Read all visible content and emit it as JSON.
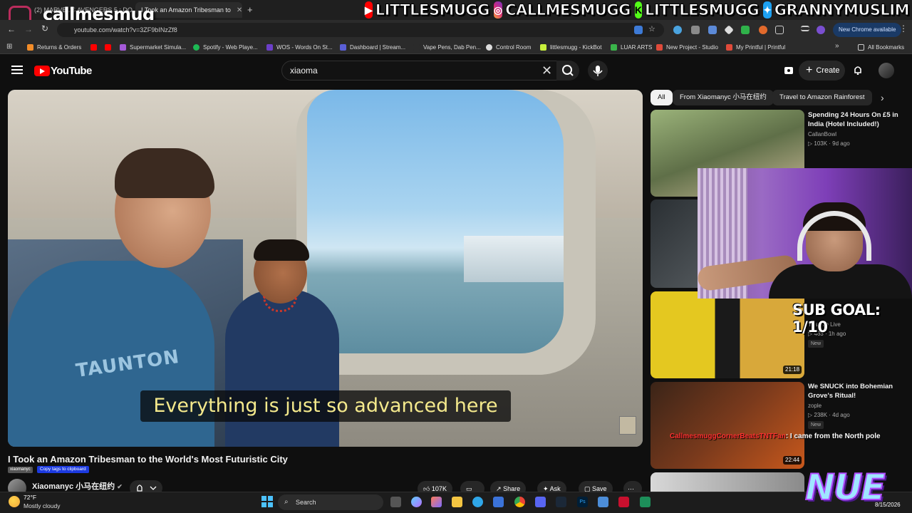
{
  "browser": {
    "tabs": [
      {
        "title": "(2) MARVEL'S AVENGERS 5 : DO",
        "active": false
      },
      {
        "title": "I Took an Amazon Tribesman to",
        "active": true
      }
    ],
    "url": "youtube.com/watch?v=3ZF9bINzZf8",
    "new_chrome_label": "New Chrome available",
    "bookmarks": [
      "Returns & Orders",
      "Supermarket Simula...",
      "Spotify - Web Playe...",
      "WOS - Words On St...",
      "Dashboard | Stream...",
      "Vape Pens, Dab Pen...",
      "Control Room",
      "littlesmugg - KickBot",
      "LUAR ARTS",
      "New Project - Studio",
      "My Printful | Printful"
    ],
    "all_bookmarks": "All Bookmarks"
  },
  "overlay": {
    "watermark": "callmesmug",
    "socials": [
      {
        "icon": "youtube-icon",
        "handle": "LITTLESMUGG",
        "color": "#ff0000"
      },
      {
        "icon": "instagram-icon",
        "handle": "CALLMESMUGG",
        "color": "#d6297a"
      },
      {
        "icon": "kick-icon",
        "handle": "LITTLESMUGG",
        "color": "#53fc18"
      },
      {
        "icon": "twitter-icon",
        "handle": "GRANNYMUSLIM",
        "color": "#1da1f2"
      }
    ],
    "sub_goal": "SUB GOAL: 1/10",
    "chat_name": "CallmesmuggCornerBeatsTNTFan",
    "chat_msg": ": I came from the North pole",
    "logo": "NUE",
    "date": "8/15/2026"
  },
  "youtube": {
    "logo": "YouTube",
    "search_query": "xiaoma",
    "create_label": "Create",
    "caption": "Everything is just so advanced here",
    "shirt_text": "TAUNTON",
    "video": {
      "title": "I Took an Amazon Tribesman to the World's Most Futuristic City",
      "tag1": "xiaomanyc",
      "tag2": "Copy tags to clipboard",
      "channel": "Xiaomanyc 小马在纽约",
      "likes": "107K",
      "share": "Share",
      "ask": "Ask",
      "save": "Save"
    },
    "chips": [
      "All",
      "From Xiaomanyc 小马在纽约",
      "Travel to Amazon Rainforest"
    ],
    "recommendations": [
      {
        "title": "Spending 24 Hours On £5 in India (Hotel Included!)",
        "channel": "CallanBowl",
        "meta": "103K · 9d ago"
      },
      {
        "title": "",
        "channel": "Yusuf7n Live",
        "meta": "463 · 1h ago",
        "badge": "New",
        "duration": "21:18"
      },
      {
        "title": "We SNUCK into Bohemian Grove's Ritual!",
        "channel": "zople",
        "meta": "238K · 4d ago",
        "badge": "New",
        "duration": "22:44"
      }
    ]
  },
  "taskbar": {
    "temp": "72°F",
    "weather": "Mostly cloudy",
    "search_label": "Search"
  }
}
